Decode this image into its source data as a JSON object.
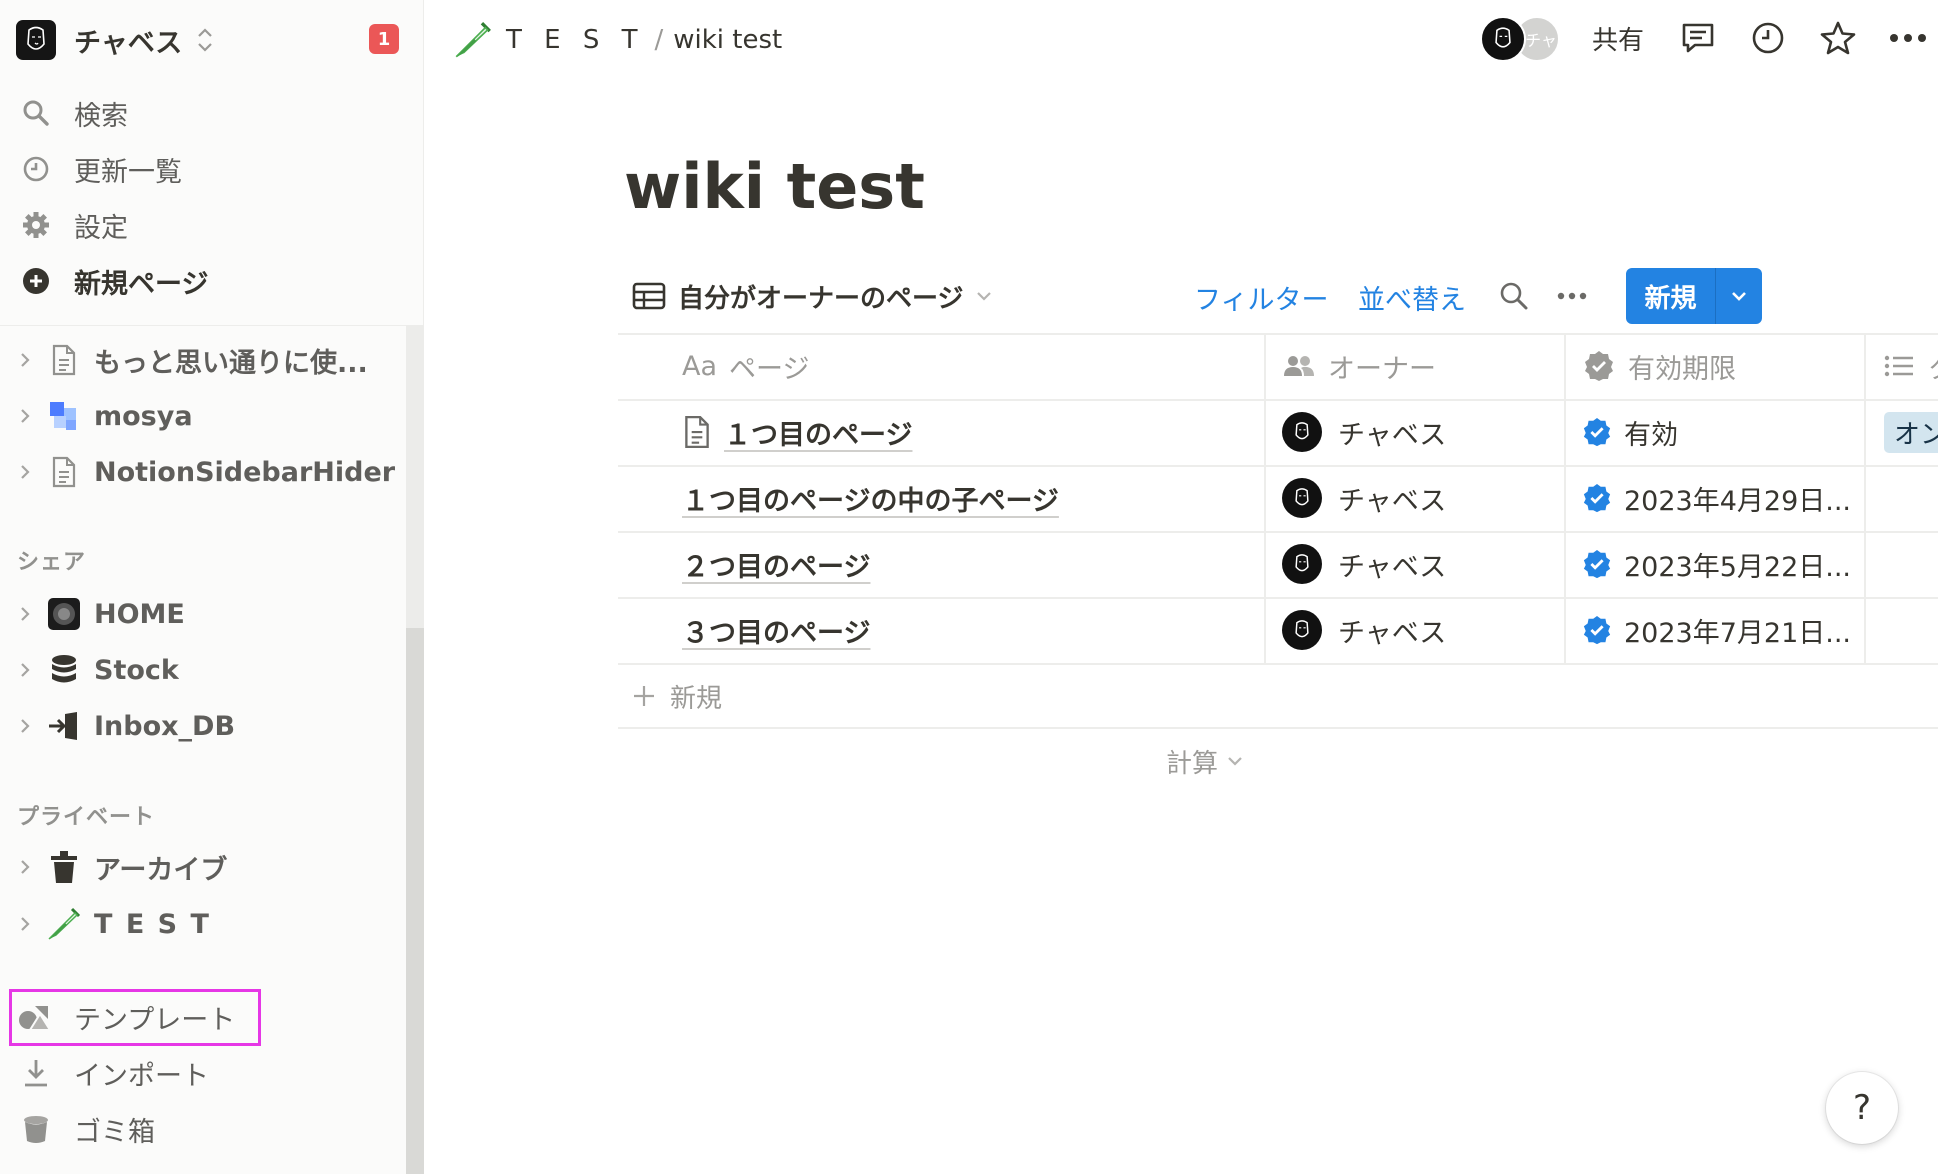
{
  "workspace": {
    "name": "チャベス",
    "notification_count": "1"
  },
  "sidebar": {
    "top_items": [
      {
        "label": "検索",
        "icon": "search-icon"
      },
      {
        "label": "更新一覧",
        "icon": "clock-icon"
      },
      {
        "label": "設定",
        "icon": "gear-icon"
      },
      {
        "label": "新規ページ",
        "icon": "plus-circle-icon"
      }
    ],
    "pages": [
      {
        "label": "もっと思い通りに使...",
        "icon": "document-icon"
      },
      {
        "label": "mosya",
        "icon": "mosya-logo-icon"
      },
      {
        "label": "NotionSidebarHider",
        "icon": "document-icon"
      }
    ],
    "shared_label": "シェア",
    "shared": [
      {
        "label": "HOME",
        "icon": "photo-icon"
      },
      {
        "label": "Stock",
        "icon": "database-icon"
      },
      {
        "label": "Inbox_DB",
        "icon": "inbox-icon"
      }
    ],
    "private_label": "プライベート",
    "private": [
      {
        "label": "アーカイブ",
        "icon": "trash-icon"
      },
      {
        "label": "T E S T",
        "icon": "test-tube-icon"
      }
    ],
    "bottom_items": [
      {
        "label": "テンプレート",
        "icon": "shapes-icon"
      },
      {
        "label": "インポート",
        "icon": "download-icon"
      },
      {
        "label": "ゴミ箱",
        "icon": "trash-can-icon"
      }
    ]
  },
  "topbar": {
    "breadcrumb": [
      "T E S T",
      "wiki test"
    ],
    "breadcrumb_sep": "/",
    "collaborator_initial": "チャ",
    "share_label": "共有"
  },
  "page": {
    "title": "wiki test",
    "view": {
      "name": "自分がオーナーのページ",
      "filter_label": "フィルター",
      "sort_label": "並べ替え",
      "new_label": "新規"
    },
    "table": {
      "columns": [
        {
          "label": "ページ",
          "prefix": "Aa",
          "icon": "text-type-icon"
        },
        {
          "label": "オーナー",
          "icon": "people-icon"
        },
        {
          "label": "有効期限",
          "icon": "verified-icon"
        },
        {
          "label": "タ",
          "icon": "list-icon"
        }
      ],
      "rows": [
        {
          "title": "１つ目のページ",
          "owner": "チャベス",
          "verification": "有効",
          "tag": "オン",
          "has_icon": true
        },
        {
          "title": "１つ目のページの中の子ページ",
          "owner": "チャベス",
          "verification": "2023年4月29日...",
          "tag": "",
          "has_icon": false
        },
        {
          "title": "２つ目のページ",
          "owner": "チャベス",
          "verification": "2023年5月22日...",
          "tag": "",
          "has_icon": false
        },
        {
          "title": "３つ目のページ",
          "owner": "チャベス",
          "verification": "2023年7月21日...",
          "tag": "",
          "has_icon": false
        }
      ],
      "add_row_label": "新規",
      "calc_label": "計算"
    }
  },
  "help_label": "?",
  "colors": {
    "accent": "#2383e2",
    "badge": "#eb5757",
    "highlight": "#e637e6",
    "tag_bg": "#d3e5ef"
  }
}
